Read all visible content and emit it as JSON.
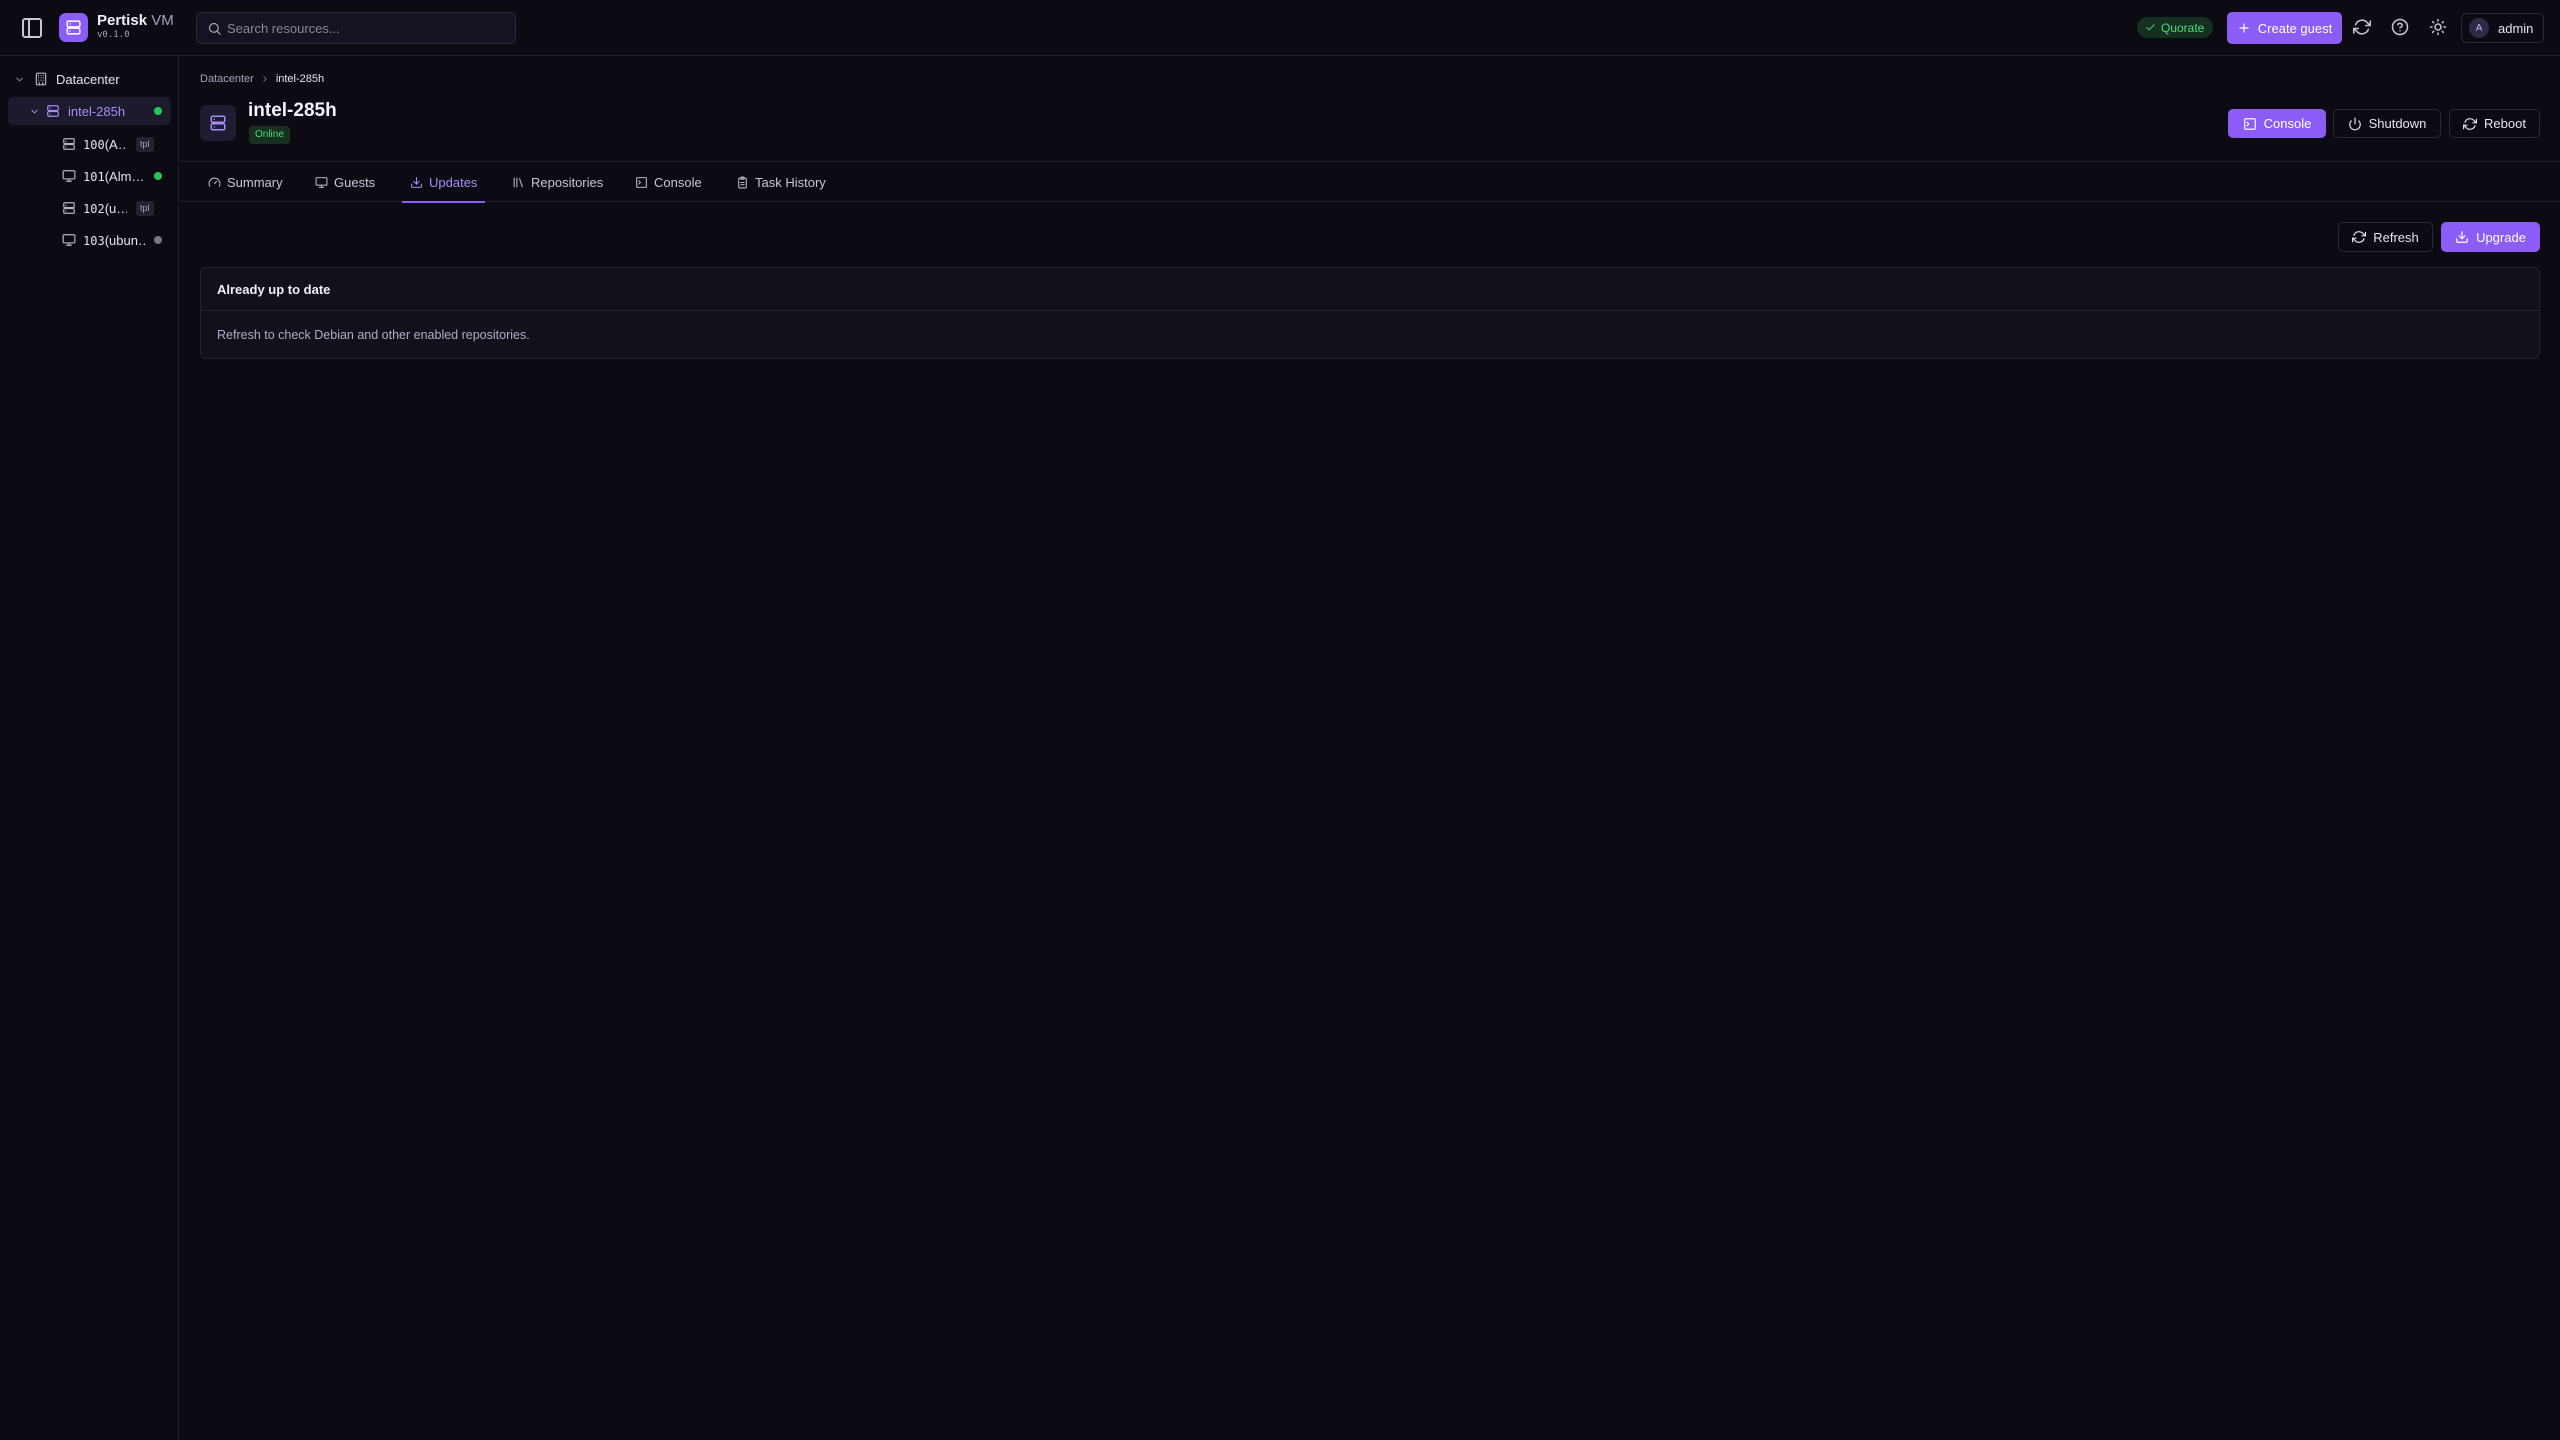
{
  "app": {
    "name": "Pertisk",
    "name_suffix": "VM",
    "version": "v0.1.0"
  },
  "search": {
    "placeholder": "Search resources..."
  },
  "topbar": {
    "quorate_label": "Quorate",
    "create_guest_label": "Create guest",
    "user_avatar_initial": "A",
    "user_name": "admin"
  },
  "sidebar": {
    "datacenter_label": "Datacenter",
    "node": {
      "label": "intel-285h",
      "status": "online",
      "status_color": "#22c55e"
    },
    "guests": [
      {
        "vmid": "100",
        "name": "(A…",
        "kind": "template",
        "badge": "tpl"
      },
      {
        "vmid": "101",
        "name": "(Alm…",
        "kind": "vm",
        "status": "running",
        "status_color": "#22c55e"
      },
      {
        "vmid": "102",
        "name": "(u…",
        "kind": "template",
        "badge": "tpl"
      },
      {
        "vmid": "103",
        "name": "(ubun…",
        "kind": "vm",
        "status": "stopped",
        "status_color": "#7a7788"
      }
    ]
  },
  "breadcrumb": {
    "root": "Datacenter",
    "current": "intel-285h"
  },
  "node_header": {
    "title": "intel-285h",
    "status": "Online",
    "console_label": "Console",
    "shutdown_label": "Shutdown",
    "reboot_label": "Reboot"
  },
  "tabs": [
    {
      "label": "Summary",
      "icon": "gauge-icon"
    },
    {
      "label": "Guests",
      "icon": "monitor-icon"
    },
    {
      "label": "Updates",
      "icon": "download-icon",
      "active": true
    },
    {
      "label": "Repositories",
      "icon": "library-icon"
    },
    {
      "label": "Console",
      "icon": "terminal-icon"
    },
    {
      "label": "Task History",
      "icon": "clipboard-icon"
    }
  ],
  "updates": {
    "refresh_label": "Refresh",
    "upgrade_label": "Upgrade",
    "status_title": "Already up to date",
    "status_message": "Refresh to check Debian and other enabled repositories."
  },
  "colors": {
    "accent": "#8b5cf6",
    "accent_text": "#a78bfa",
    "background": "#0c0b14",
    "online_green": "#4ade80"
  }
}
